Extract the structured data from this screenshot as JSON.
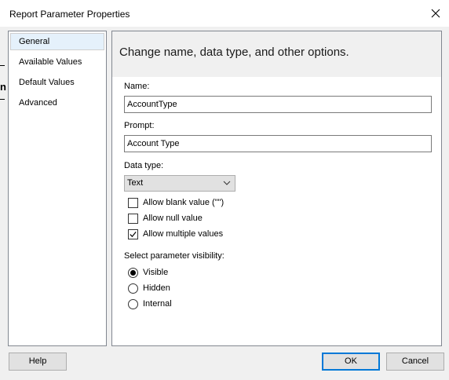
{
  "window": {
    "title": "Report Parameter Properties",
    "close_icon": "close-icon"
  },
  "sidebar": {
    "items": [
      {
        "label": "General",
        "selected": true
      },
      {
        "label": "Available Values",
        "selected": false
      },
      {
        "label": "Default Values",
        "selected": false
      },
      {
        "label": "Advanced",
        "selected": false
      }
    ]
  },
  "content": {
    "header": "Change name, data type, and other options.",
    "name_label": "Name:",
    "name_value": "AccountType",
    "prompt_label": "Prompt:",
    "prompt_value": "Account Type",
    "datatype_label": "Data type:",
    "datatype_value": "Text",
    "options": [
      {
        "label": "Allow blank value (\"\")",
        "checked": false
      },
      {
        "label": "Allow null value",
        "checked": false
      },
      {
        "label": "Allow multiple values",
        "checked": true
      }
    ],
    "visibility_label": "Select parameter visibility:",
    "visibility": [
      {
        "label": "Visible",
        "selected": true
      },
      {
        "label": "Hidden",
        "selected": false
      },
      {
        "label": "Internal",
        "selected": false
      }
    ]
  },
  "footer": {
    "help_label": "Help",
    "ok_label": "OK",
    "cancel_label": "Cancel"
  },
  "colors": {
    "accent": "#0078d7",
    "selected_bg": "#e5f1fb"
  }
}
